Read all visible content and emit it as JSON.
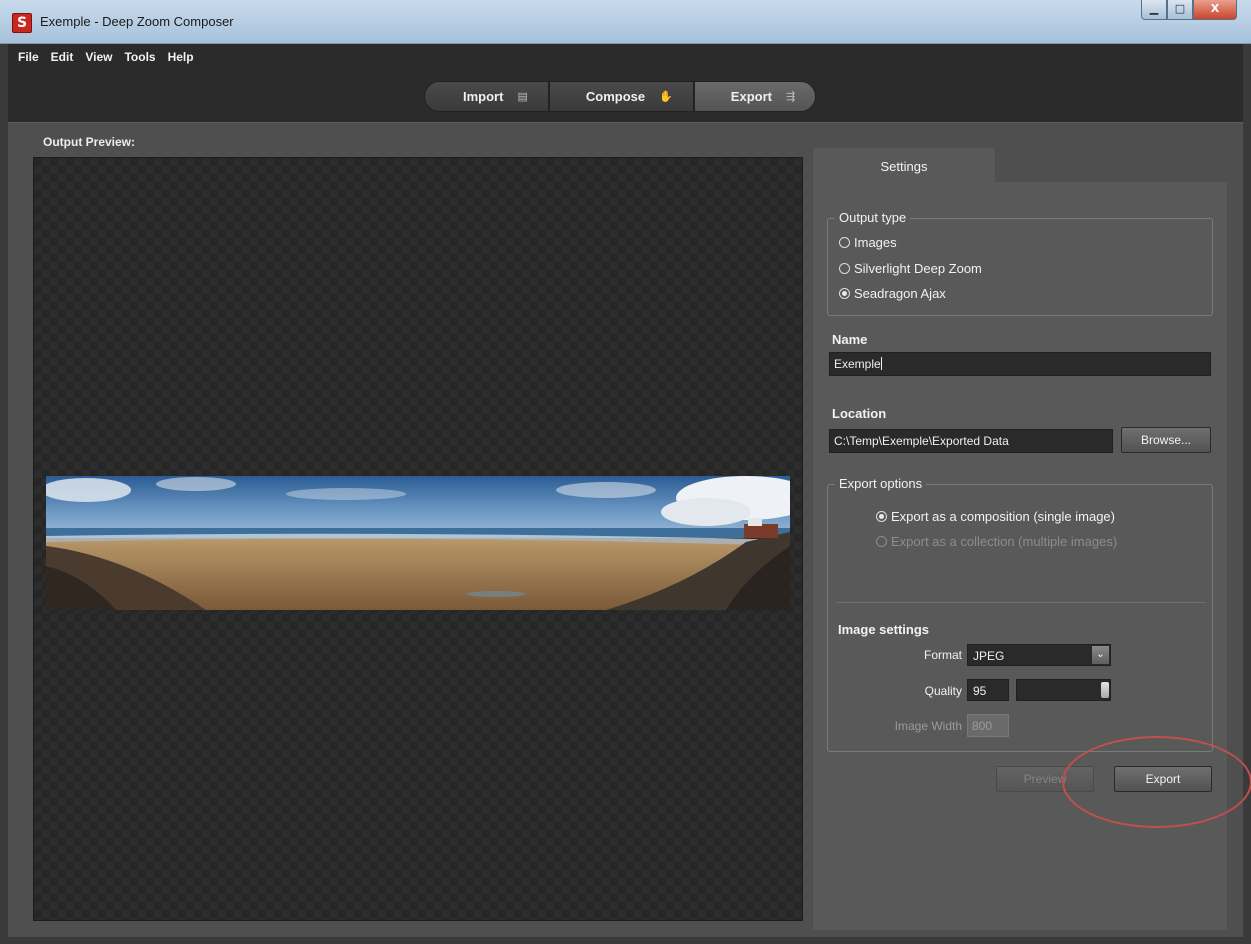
{
  "window": {
    "title": "Exemple - Deep Zoom Composer",
    "min": "▁",
    "max": "□",
    "close": "X"
  },
  "menu": [
    "File",
    "Edit",
    "View",
    "Tools",
    "Help"
  ],
  "modes": [
    {
      "label": "Import",
      "icon": "import-icon"
    },
    {
      "label": "Compose",
      "icon": "hand-icon"
    },
    {
      "label": "Export",
      "icon": "export-icon"
    }
  ],
  "preview": {
    "label": "Output Preview:"
  },
  "settings": {
    "tab": "Settings",
    "output_type": {
      "legend": "Output type",
      "options": [
        "Images",
        "Silverlight Deep Zoom",
        "Seadragon Ajax"
      ],
      "selected": "Seadragon Ajax"
    },
    "name": {
      "label": "Name",
      "value": "Exemple"
    },
    "location": {
      "label": "Location",
      "value": "C:\\Temp\\Exemple\\Exported Data",
      "browse": "Browse..."
    },
    "export_options": {
      "legend": "Export options",
      "composition": "Export as a composition (single image)",
      "collection": "Export as a collection (multiple images)"
    },
    "image_settings": {
      "label": "Image settings",
      "format_label": "Format",
      "format_value": "JPEG",
      "quality_label": "Quality",
      "quality_value": "95",
      "width_label": "Image Width",
      "width_value": "800"
    },
    "buttons": {
      "preview": "Preview",
      "export": "Export"
    }
  },
  "colors": {
    "annotation": "#c0504d",
    "panel": "#595959",
    "background": "#2b2b2b"
  }
}
